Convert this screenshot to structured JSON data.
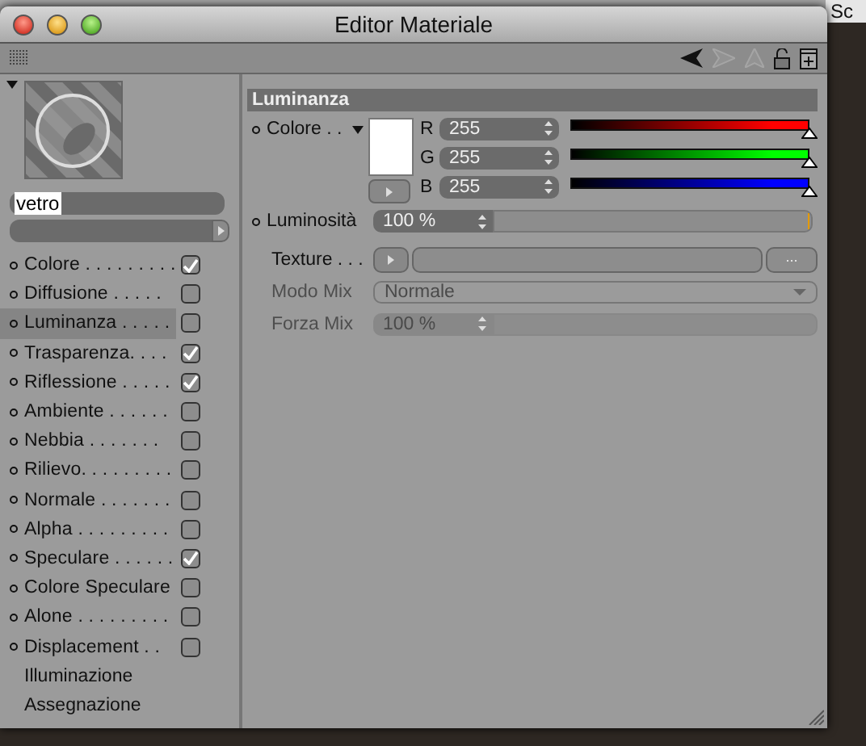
{
  "background_tab": "Sc",
  "window": {
    "title": "Editor Materiale"
  },
  "material": {
    "name": "vetro"
  },
  "channels": [
    {
      "label": "Colore . . . . . . . . .",
      "checked": true,
      "selected": false
    },
    {
      "label": "Diffusione  . . . . .",
      "checked": false,
      "selected": false
    },
    {
      "label": "Luminanza . . . . .",
      "checked": false,
      "selected": true
    },
    {
      "label": "Trasparenza. . . .",
      "checked": true,
      "selected": false
    },
    {
      "label": "Riflessione . . . . .",
      "checked": true,
      "selected": false
    },
    {
      "label": "Ambiente . . . . . .",
      "checked": false,
      "selected": false
    },
    {
      "label": "Nebbia . . . . . . .",
      "checked": false,
      "selected": false
    },
    {
      "label": "Rilievo. . . . . . . . .",
      "checked": false,
      "selected": false
    },
    {
      "label": "Normale . . . . . . .",
      "checked": false,
      "selected": false
    },
    {
      "label": "Alpha . . . . . . . . .",
      "checked": false,
      "selected": false
    },
    {
      "label": "Speculare . . . . . .",
      "checked": true,
      "selected": false
    },
    {
      "label": "Colore Speculare",
      "checked": false,
      "selected": false
    },
    {
      "label": "Alone . . . . . . . . .",
      "checked": false,
      "selected": false
    },
    {
      "label": "Displacement  . .",
      "checked": false,
      "selected": false
    }
  ],
  "extra_items": [
    "Illuminazione",
    "Assegnazione"
  ],
  "section": {
    "title": "Luminanza"
  },
  "color": {
    "label": "Colore . .",
    "components": [
      {
        "name": "R",
        "value": "255",
        "level": 1,
        "color": "#ff0000"
      },
      {
        "name": "G",
        "value": "255",
        "level": 1,
        "color": "#00ff00"
      },
      {
        "name": "B",
        "value": "255",
        "level": 1,
        "color": "#0000ff"
      }
    ]
  },
  "luminosity": {
    "label": "Luminosità",
    "value": "100 %",
    "level": 1
  },
  "texture": {
    "label": "Texture . . .",
    "browse": "..."
  },
  "mix_mode": {
    "label": "Modo Mix",
    "value": "Normale",
    "disabled": true
  },
  "mix_strength": {
    "label": "Forza Mix",
    "value": "100 %",
    "disabled": true
  }
}
